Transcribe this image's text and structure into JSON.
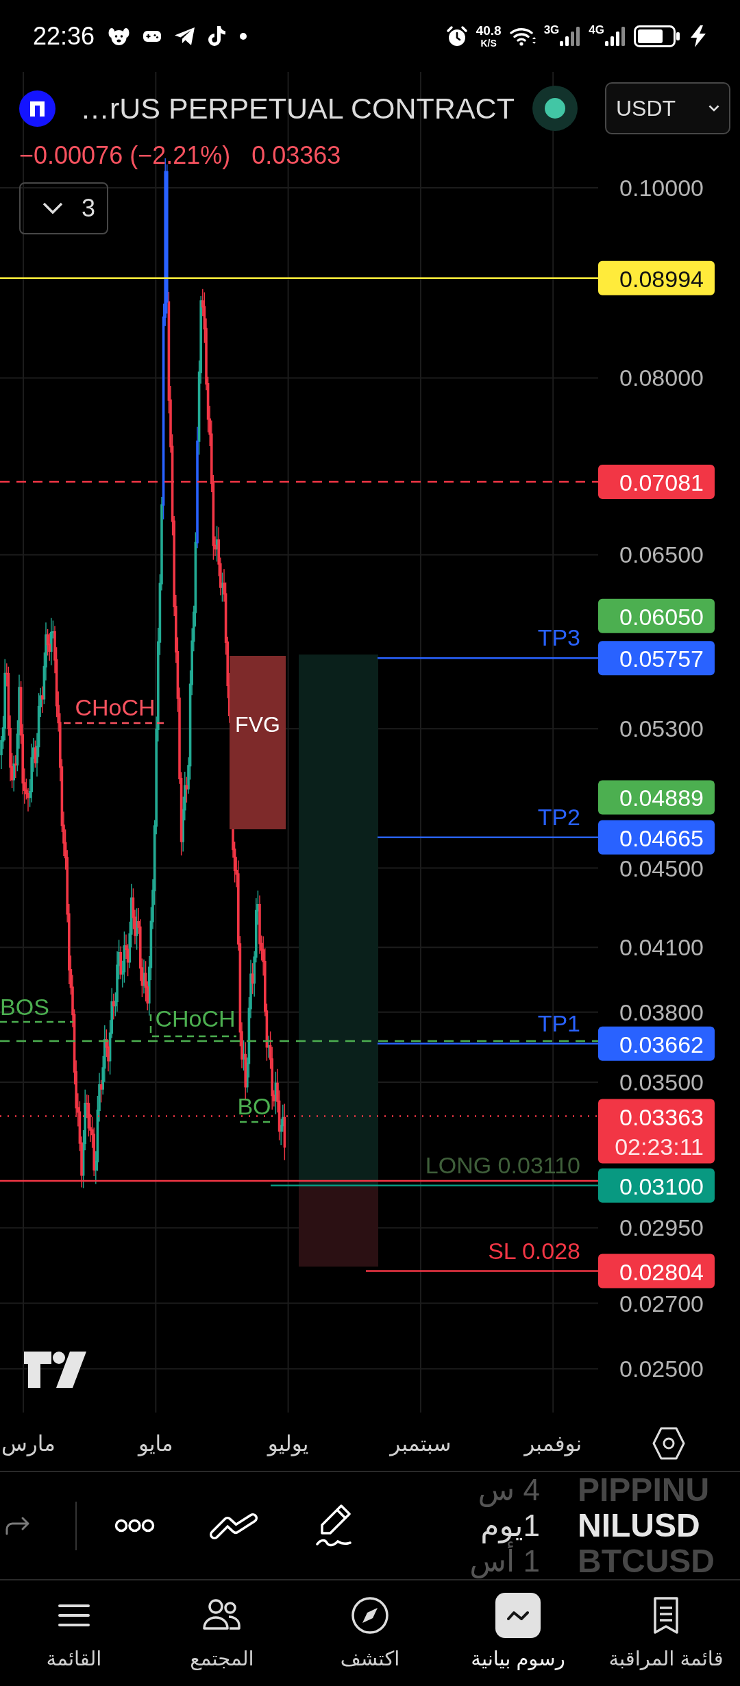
{
  "status_bar": {
    "time": "22:36",
    "speed": "40.8",
    "speed_unit": "K/S",
    "networks": [
      {
        "label": "3G"
      },
      {
        "label": "4G"
      }
    ]
  },
  "header": {
    "title": "…rUS PERPETUAL CONTRACT",
    "currency": "USDT",
    "change": "−0.00076 (−2.21%)",
    "last_price": "0.03363",
    "indicators_count": "3"
  },
  "chart": {
    "price_ticks": [
      "0.10000",
      "0.08000",
      "0.06500",
      "0.05300",
      "0.04500",
      "0.04100",
      "0.03800",
      "0.03500",
      "0.02950",
      "0.02700",
      "0.02500"
    ],
    "price_markers": [
      {
        "kind": "horizontal_line",
        "value": "0.08994",
        "color": "#ffeb3b"
      },
      {
        "kind": "alert",
        "value": "0.07081",
        "color": "#f23645"
      },
      {
        "kind": "label",
        "value": "0.06050",
        "color": "#4caf50"
      },
      {
        "kind": "target",
        "value": "0.05757",
        "color": "#2962ff",
        "note": "TP3"
      },
      {
        "kind": "label",
        "value": "0.04889",
        "color": "#4caf50"
      },
      {
        "kind": "target",
        "value": "0.04665",
        "color": "#2962ff",
        "note": "TP2"
      },
      {
        "kind": "target",
        "value": "0.03662",
        "color": "#2962ff",
        "note": "TP1"
      },
      {
        "kind": "last_price",
        "value": "0.03363",
        "color": "#f23645",
        "countdown": "02:23:11"
      },
      {
        "kind": "entry",
        "value": "0.03100",
        "color": "#089981",
        "note": "LONG 0.03110"
      },
      {
        "kind": "stop",
        "value": "0.02804",
        "color": "#f23645",
        "note": "SL 0.028"
      }
    ],
    "structures": [
      {
        "kind": "choch",
        "label": "CHoCH",
        "color": "#f7525f"
      },
      {
        "kind": "fvg",
        "label": "FVG",
        "color": "#7e2a2a"
      },
      {
        "kind": "bos",
        "label": "BOS",
        "color": "#4caf50"
      },
      {
        "kind": "choch",
        "label": "CHoCH",
        "color": "#4caf50"
      },
      {
        "kind": "bos",
        "label": "BO",
        "color": "#4caf50"
      }
    ],
    "time_labels": [
      "نوفمبر",
      "سبتمبر",
      "يوليو",
      "مايو",
      "مارس"
    ]
  },
  "toolbar": {
    "redo": {
      "disabled": true
    },
    "intervals": [
      {
        "label": "4 س",
        "selected": false
      },
      {
        "label": "1يوم",
        "selected": true
      },
      {
        "label": "1 أس",
        "selected": false
      }
    ],
    "symbols": [
      {
        "label": "PIPPINU",
        "selected": false
      },
      {
        "label": "NILUSD",
        "selected": true
      },
      {
        "label": "BTCUSD",
        "selected": false
      }
    ]
  },
  "bottom_nav": [
    {
      "kind": "watchlist",
      "label": "قائمة المراقبة",
      "selected": false
    },
    {
      "kind": "charts",
      "label": "رسوم بيانية",
      "selected": true
    },
    {
      "kind": "explore",
      "label": "اكتشف",
      "selected": false
    },
    {
      "kind": "community",
      "label": "المجتمع",
      "selected": false
    },
    {
      "kind": "menu",
      "label": "القائمة",
      "selected": false
    }
  ]
}
